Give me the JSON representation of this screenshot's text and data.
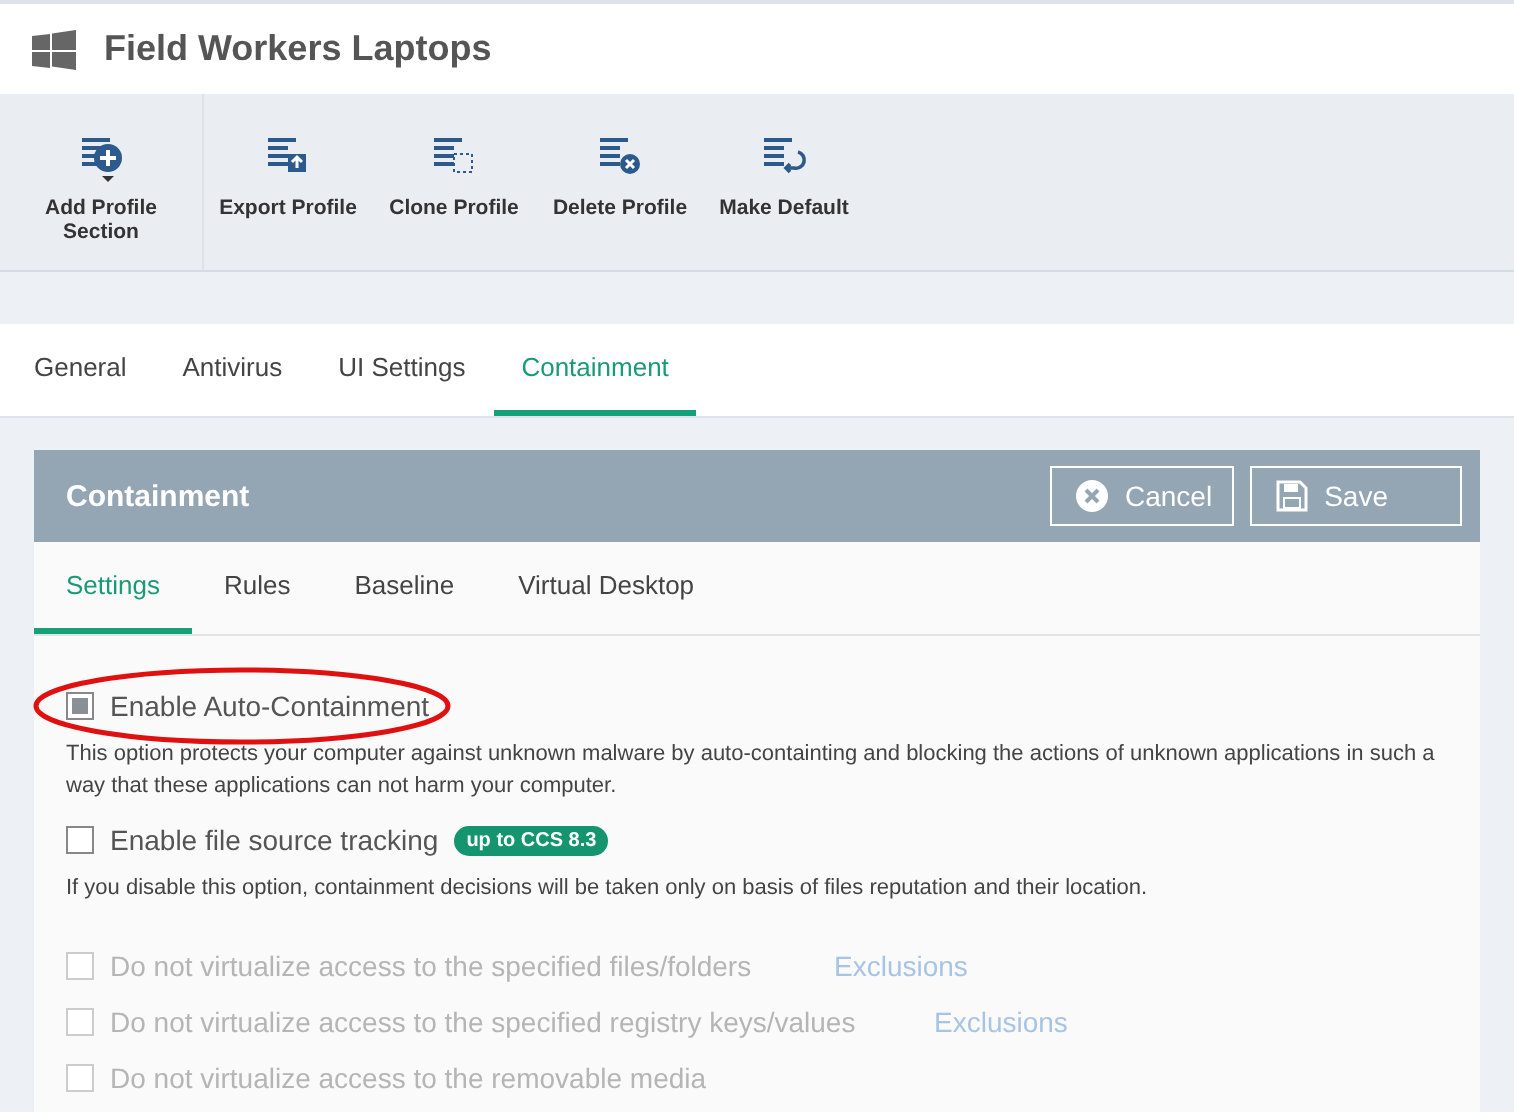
{
  "window": {
    "title": "Field Workers Laptops"
  },
  "toolbar": [
    {
      "label": "Add Profile Section",
      "kind": "add"
    },
    {
      "label": "Export Profile",
      "kind": "export"
    },
    {
      "label": "Clone Profile",
      "kind": "clone"
    },
    {
      "label": "Delete Profile",
      "kind": "delete"
    },
    {
      "label": "Make Default",
      "kind": "default"
    }
  ],
  "tabs": [
    {
      "label": "General",
      "selected": false
    },
    {
      "label": "Antivirus",
      "selected": false
    },
    {
      "label": "UI Settings",
      "selected": false
    },
    {
      "label": "Containment",
      "selected": true
    }
  ],
  "panel": {
    "title": "Containment",
    "buttons": [
      {
        "label": "Cancel",
        "kind": "cancel"
      },
      {
        "label": "Save",
        "kind": "save"
      }
    ],
    "subtabs": [
      {
        "label": "Settings",
        "selected": true
      },
      {
        "label": "Rules",
        "selected": false
      },
      {
        "label": "Baseline",
        "selected": false
      },
      {
        "label": "Virtual Desktop",
        "selected": false
      }
    ],
    "options": [
      {
        "label": "Enable Auto-Containment",
        "checked": true,
        "disabled": false,
        "highlighted": true,
        "description": "This option protects your computer against unknown malware by auto-containting and blocking the actions of unknown applications in such a way that these applications can not harm your computer."
      },
      {
        "label": "Enable file source tracking",
        "checked": false,
        "disabled": false,
        "highlighted": false,
        "badge": "up to CCS 8.3",
        "description": "If you disable this option, containment decisions will be taken only on basis of files reputation and their location."
      },
      {
        "label": "Do not virtualize access to the specified files/folders",
        "checked": false,
        "disabled": true,
        "highlighted": false,
        "link": "Exclusions"
      },
      {
        "label": "Do not virtualize access to the specified registry keys/values",
        "checked": false,
        "disabled": true,
        "highlighted": false,
        "link": "Exclusions"
      },
      {
        "label": "Do not virtualize access to the removable media",
        "checked": false,
        "disabled": true,
        "highlighted": false
      }
    ]
  }
}
